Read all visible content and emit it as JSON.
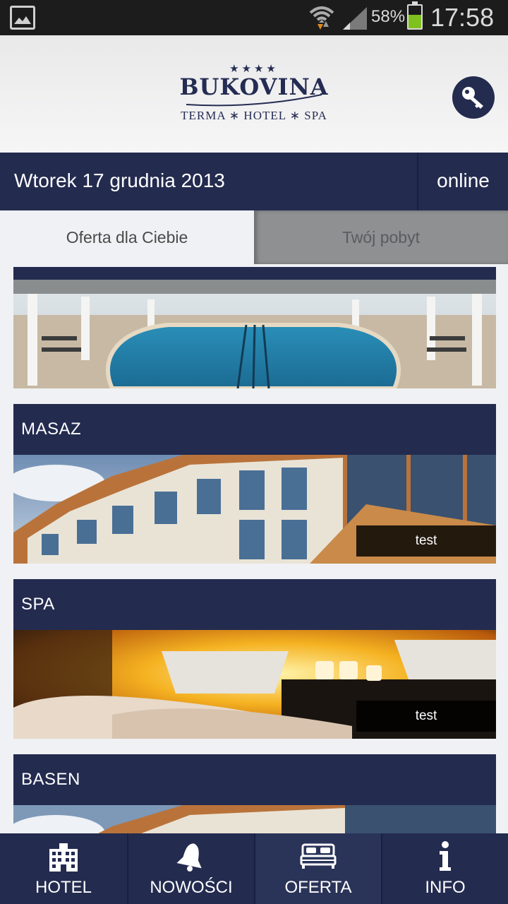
{
  "status_bar": {
    "battery_percent": "58%",
    "battery_level": 0.58,
    "time": "17:58",
    "icons": [
      "image-icon",
      "wifi-icon",
      "signal-icon",
      "battery-icon"
    ]
  },
  "header": {
    "logo": {
      "stars": "★★★★",
      "name": "BUKOVINA",
      "subtitle": "TERMA ∗ HOTEL ∗ SPA"
    },
    "key_icon": "key-icon"
  },
  "date_bar": {
    "date": "Wtorek 17 grudnia 2013",
    "status": "online"
  },
  "tabs": [
    {
      "label": "Oferta dla Ciebie",
      "active": true
    },
    {
      "label": "Twój pobyt",
      "active": false
    }
  ],
  "offers": [
    {
      "title": "",
      "caption": ""
    },
    {
      "title": "MASAZ",
      "caption": "test"
    },
    {
      "title": "SPA",
      "caption": "test"
    },
    {
      "title": "BASEN",
      "caption": ""
    }
  ],
  "bottom_nav": [
    {
      "label": "HOTEL",
      "icon": "building-icon",
      "active": false
    },
    {
      "label": "NOWOŚCI",
      "icon": "bell-icon",
      "active": false
    },
    {
      "label": "OFERTA",
      "icon": "bed-icon",
      "active": true
    },
    {
      "label": "INFO",
      "icon": "info-icon",
      "active": false
    }
  ],
  "colors": {
    "primary": "#232b4f",
    "battery_fill": "#7fc11d",
    "background": "#f0f1f4"
  }
}
